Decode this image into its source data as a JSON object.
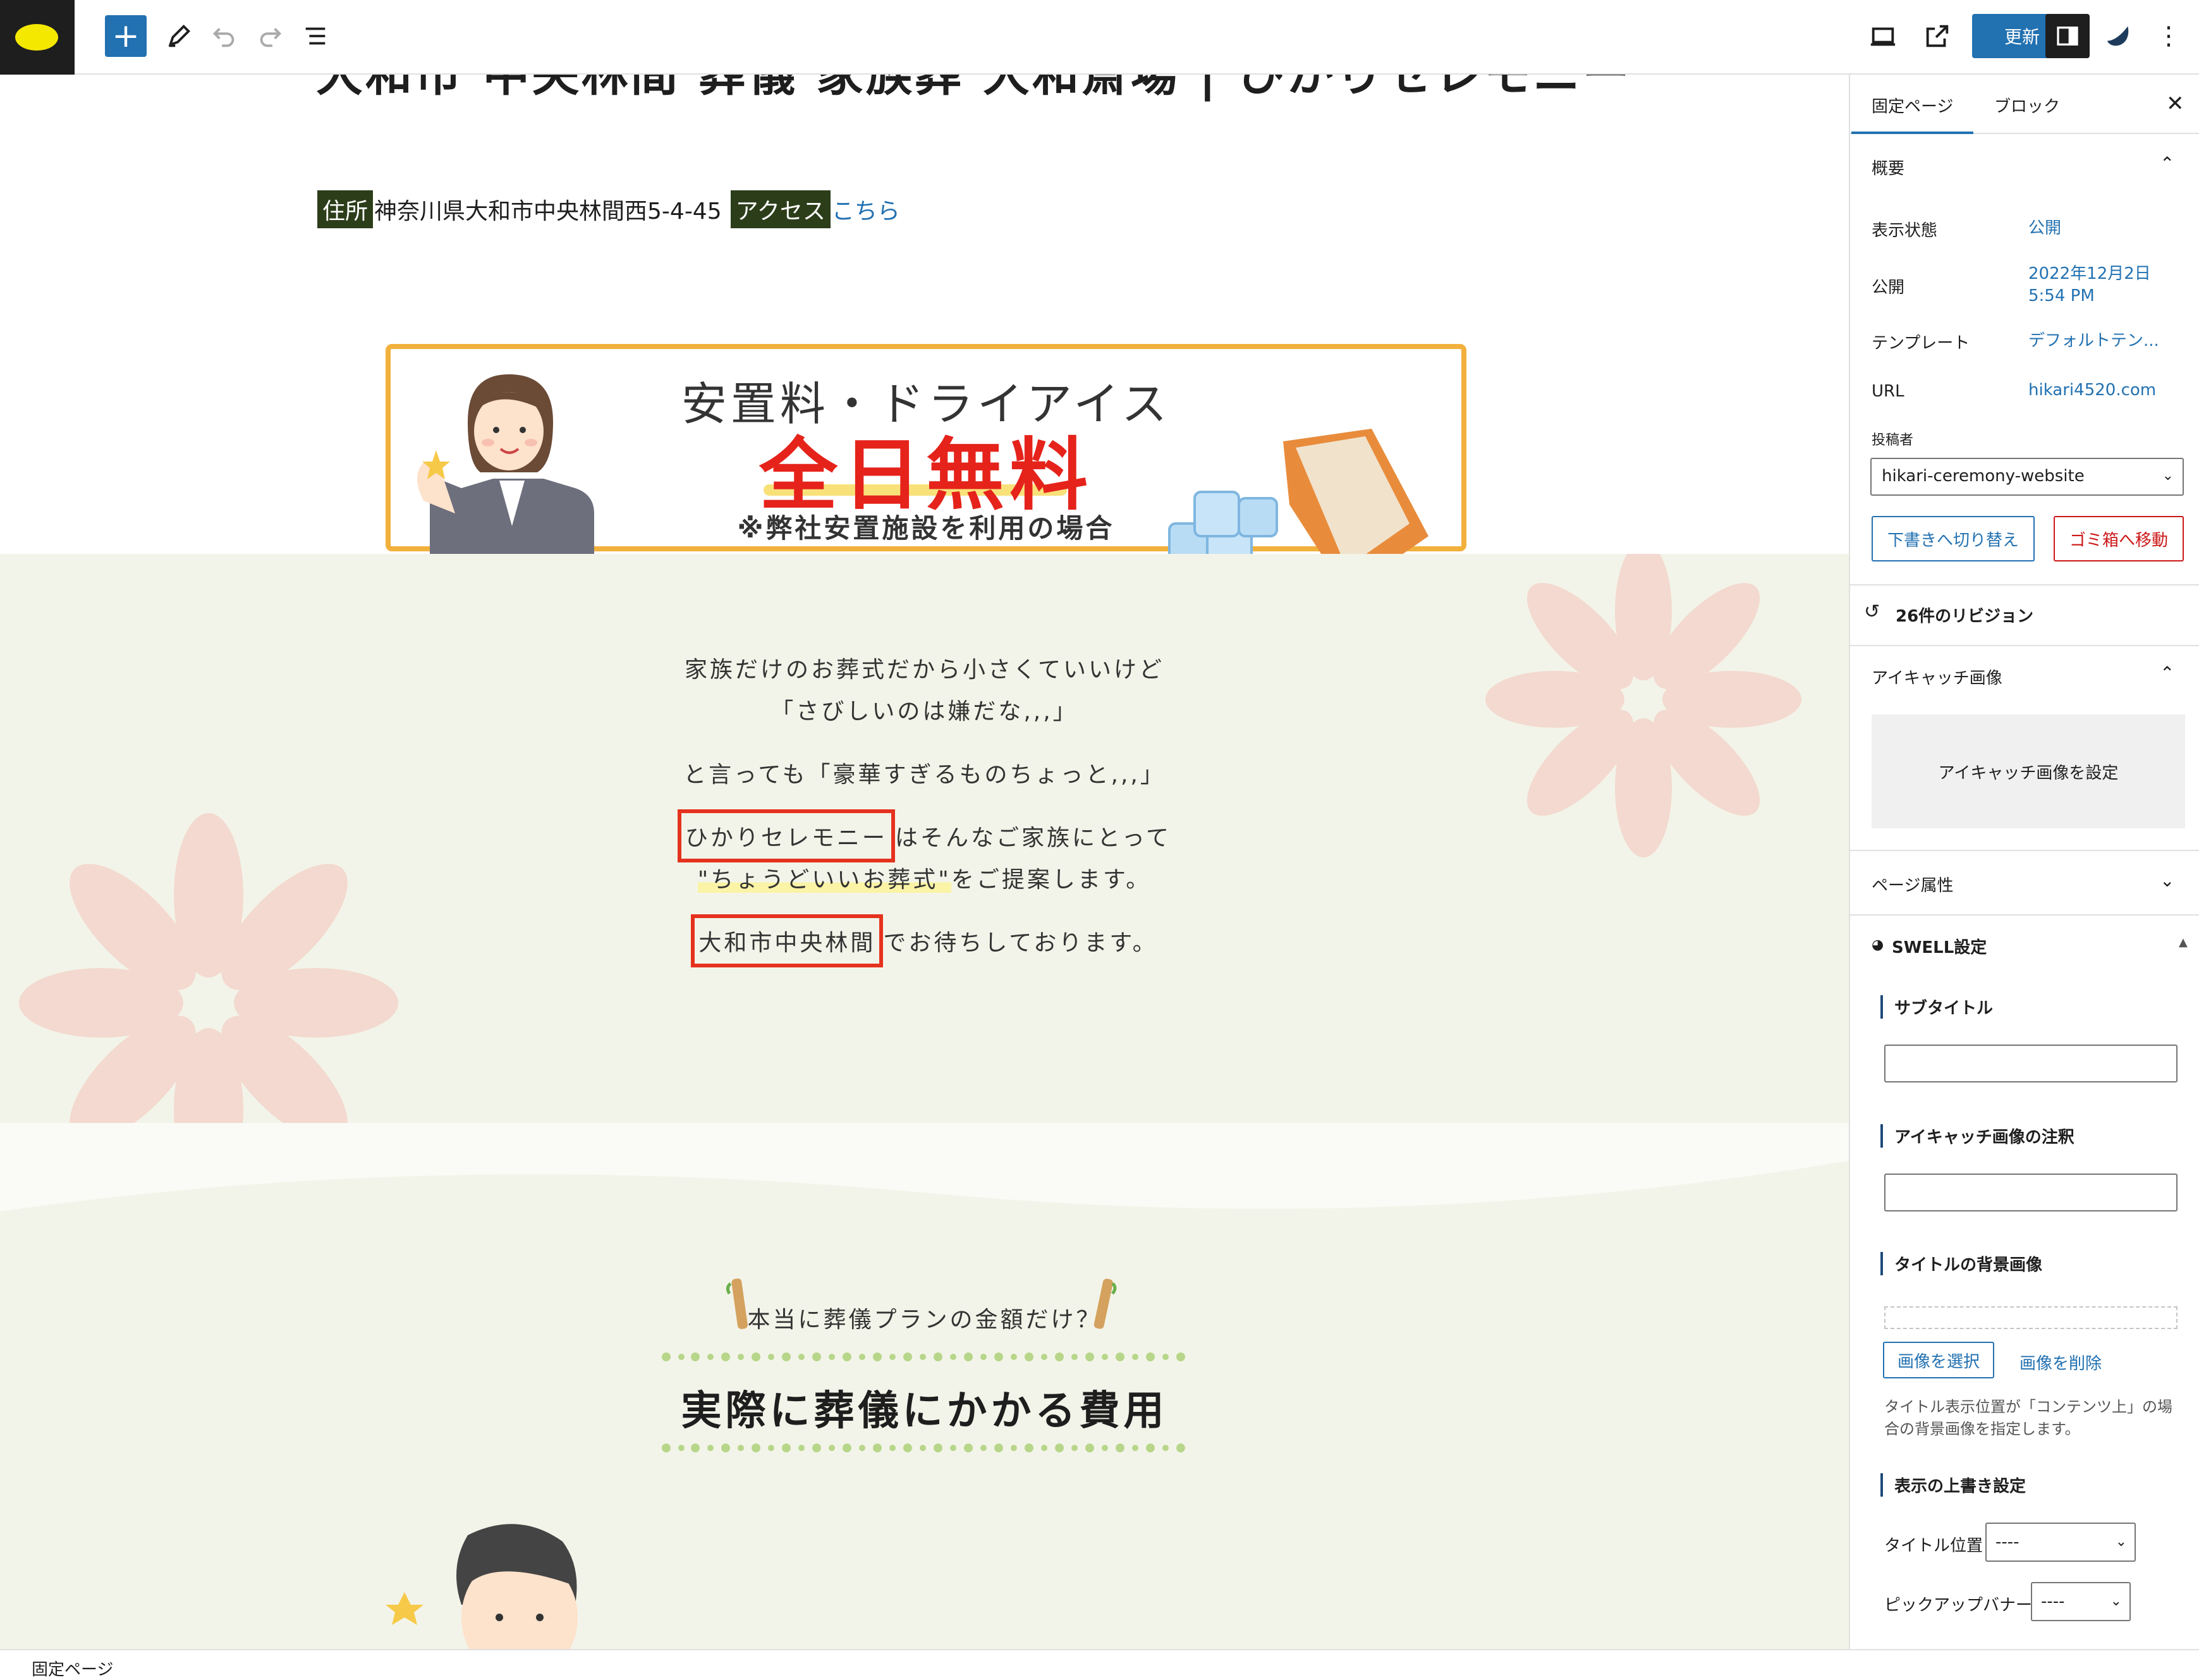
{
  "toolbar": {
    "update_label": "更新"
  },
  "canvas": {
    "page_title": "大和市 中央林間 葬儀 家族葬 大和斎場 | ひかりセレモニー",
    "address_tag": "住所",
    "address": "神奈川県大和市中央林間西5-4-45",
    "access_tag": "アクセス",
    "access_link": "こちら",
    "banner": {
      "line1": "安置料・ドライアイス",
      "line2": "全日無料",
      "line3": "※弊社安置施設を利用の場合"
    },
    "message": {
      "p1_line1": "家族だけのお葬式だから小さくていいけど",
      "p1_line2": "「さびしいのは嫌だな,,,」",
      "p2": "と言っても「豪華すぎるものちょっと,,,」",
      "p3_highlight": "ひかりセレモニー",
      "p3_rest": "はそんなご家族にとって",
      "p4_quote": "\"ちょうどいいお葬式\"",
      "p4_rest": "をご提案します。",
      "p5_highlight": "大和市中央林間",
      "p5_rest": "でお待ちしております。"
    },
    "sub_heading": "本当に葬儀プランの金額だけ？",
    "big_heading": "実際に葬儀にかかる費用"
  },
  "sidebar": {
    "tab_page": "固定ページ",
    "tab_block": "ブロック",
    "summary": "概要",
    "visibility_label": "表示状態",
    "visibility_value": "公開",
    "publish_label": "公開",
    "publish_value_date": "2022年12月2日",
    "publish_value_time": "5:54 PM",
    "template_label": "テンプレート",
    "template_value": "デフォルトテン...",
    "url_label": "URL",
    "url_value": "hikari4520.com",
    "author_label": "投稿者",
    "author_value": "hikari-ceremony-website",
    "draft_button": "下書きへ切り替え",
    "trash_button": "ゴミ箱へ移動",
    "revisions": "26件のリビジョン",
    "featured_image_head": "アイキャッチ画像",
    "featured_image_set": "アイキャッチ画像を設定",
    "page_attributes": "ページ属性",
    "swell_settings": "SWELL設定",
    "subtitle_label": "サブタイトル",
    "featured_caption_label": "アイキャッチ画像の注釈",
    "title_bg_label": "タイトルの背景画像",
    "select_image": "画像を選択",
    "remove_image": "画像を削除",
    "title_bg_help": "タイトル表示位置が「コンテンツ上」の場合の背景画像を指定します。",
    "display_override": "表示の上書き設定",
    "title_position_label": "タイトル位置",
    "title_position_value": "----",
    "pickup_banner_label": "ピックアップバナー",
    "pickup_banner_value": "----"
  },
  "footer": {
    "breadcrumb": "固定ページ"
  }
}
